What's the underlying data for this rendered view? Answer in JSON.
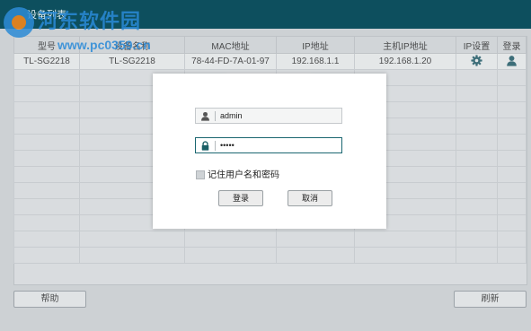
{
  "watermark": {
    "site_name": "河东软件园",
    "site_url": "www.pc0359.cn"
  },
  "window": {
    "title": "设备列表"
  },
  "table": {
    "columns": [
      "型号",
      "设备名称",
      "MAC地址",
      "IP地址",
      "主机IP地址",
      "IP设置",
      "登录"
    ],
    "rows": [
      {
        "model": "TL-SG2218",
        "name": "TL-SG2218",
        "mac": "78-44-FD-7A-01-97",
        "ip": "192.168.1.1",
        "host_ip": "192.168.1.20",
        "ip_setting_icon": "gear-icon",
        "login_icon": "user-icon"
      }
    ],
    "empty_rows": 12
  },
  "buttons": {
    "help": "帮助",
    "refresh": "刷新"
  },
  "login_dialog": {
    "username_value": "admin",
    "password_value": "•••••",
    "remember_label": "记住用户名和密码",
    "remember_checked": false,
    "login_button": "登录",
    "cancel_button": "取消",
    "user_icon": "user-icon",
    "lock_icon": "lock-icon"
  },
  "colors": {
    "titlebar": "#0d4f5e",
    "accent": "#1a6670",
    "watermark": "#2a8ad8"
  }
}
